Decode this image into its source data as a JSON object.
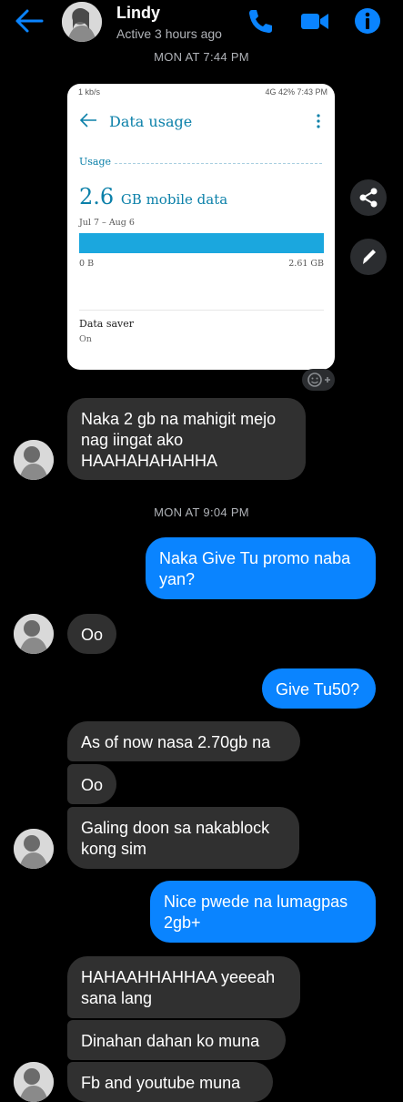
{
  "header": {
    "contact_name": "Lindy",
    "status": "Active 3 hours ago"
  },
  "accent_color": "#0a84ff",
  "stamps": [
    "MON AT 7:44 PM",
    "MON AT 9:04 PM"
  ],
  "shared_screenshot": {
    "status_bar_left": "1 kb/s",
    "status_bar_right": "4G  42%  7:43 PM",
    "title": "Data usage",
    "section": "Usage",
    "amount": "2.6",
    "amount_unit": "GB mobile data",
    "date_range": "Jul 7 – Aug 6",
    "bar_fill_fraction": 1.0,
    "bar_left_label": "0 B",
    "bar_right_label": "2.61 GB",
    "data_saver_label": "Data saver",
    "data_saver_value": "On"
  },
  "messages": [
    {
      "from": "them",
      "text": "Naka 2 gb na mahigit mejo nag iingat ako HAAHAHAHAHHA"
    },
    {
      "from": "me",
      "text": "Naka Give Tu promo naba yan?"
    },
    {
      "from": "them",
      "text": "Oo"
    },
    {
      "from": "me",
      "text": "Give Tu50?"
    },
    {
      "from": "them",
      "text": "As of now nasa 2.70gb na"
    },
    {
      "from": "them",
      "text": "Oo"
    },
    {
      "from": "them",
      "text": "Galing doon sa nakablock kong sim"
    },
    {
      "from": "me",
      "text": "Nice pwede na lumagpas 2gb+"
    },
    {
      "from": "them",
      "text": "HAHAAHHAHHAA yeeeah sana lang"
    },
    {
      "from": "them",
      "text": "Dinahan dahan ko muna"
    },
    {
      "from": "them",
      "text": "Fb and youtube muna"
    }
  ],
  "icons": [
    "back-arrow-icon",
    "phone-icon",
    "video-camera-icon",
    "info-icon",
    "share-icon",
    "pencil-icon",
    "add-reaction-icon"
  ]
}
